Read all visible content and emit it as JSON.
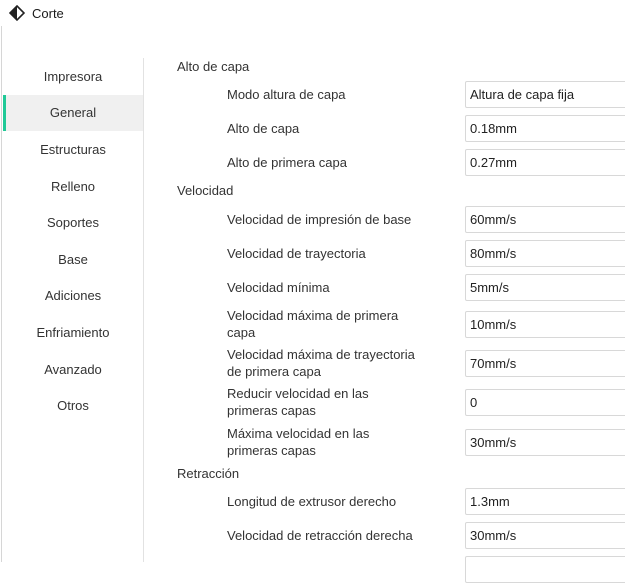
{
  "window": {
    "title": "Corte"
  },
  "sidebar": {
    "items": [
      {
        "label": "Impresora",
        "active": false
      },
      {
        "label": "General",
        "active": true
      },
      {
        "label": "Estructuras",
        "active": false
      },
      {
        "label": "Relleno",
        "active": false
      },
      {
        "label": "Soportes",
        "active": false
      },
      {
        "label": "Base",
        "active": false
      },
      {
        "label": "Adiciones",
        "active": false
      },
      {
        "label": "Enfriamiento",
        "active": false
      },
      {
        "label": "Avanzado",
        "active": false
      },
      {
        "label": "Otros",
        "active": false
      }
    ],
    "accent_color": "#20c997"
  },
  "sections": {
    "layer_height": {
      "title": "Alto de capa",
      "mode_label": "Modo altura de capa",
      "mode_value": "Altura de capa fija",
      "height_label": "Alto de capa",
      "height_value": "0.18mm",
      "first_label": "Alto de primera capa",
      "first_value": "0.27mm"
    },
    "speed": {
      "title": "Velocidad",
      "base_label": "Velocidad de impresión de base",
      "base_value": "60mm/s",
      "travel_label": "Velocidad de trayectoria",
      "travel_value": "80mm/s",
      "min_label": "Velocidad mínima",
      "min_value": "5mm/s",
      "max_first_label_1": "Velocidad máxima de primera",
      "max_first_label_2": "capa",
      "max_first_value": "10mm/s",
      "max_travel_first_label_1": "Velocidad máxima de trayectoria",
      "max_travel_first_label_2": "de primera capa",
      "max_travel_first_value": "70mm/s",
      "slow_first_label_1": "Reducir velocidad en las",
      "slow_first_label_2": "primeras capas",
      "slow_first_value": "0",
      "max_speed_first_label_1": "Máxima velocidad en las",
      "max_speed_first_label_2": "primeras capas",
      "max_speed_first_value": "30mm/s"
    },
    "retraction": {
      "title": "Retracción",
      "length_label": "Longitud de extrusor derecho",
      "length_value": "1.3mm",
      "speed_label": "Velocidad de retracción derecha",
      "speed_value": "30mm/s"
    }
  }
}
